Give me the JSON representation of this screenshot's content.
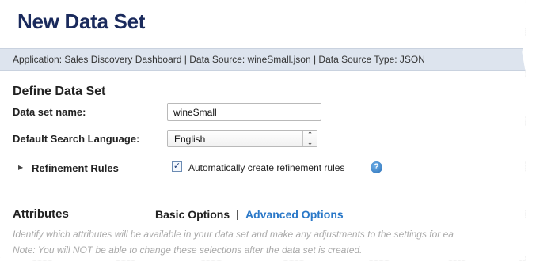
{
  "header": {
    "title": "New Data Set"
  },
  "info_bar": {
    "text": "Application: Sales Discovery Dashboard | Data Source: wineSmall.json | Data Source Type: JSON"
  },
  "define": {
    "section_title": "Define Data Set",
    "name_label": "Data set name:",
    "name_value": "wineSmall",
    "language_label": "Default Search Language:",
    "language_value": "English",
    "refinement_label": "Refinement Rules",
    "auto_refine_label": "Automatically create refinement rules",
    "auto_refine_checked": true
  },
  "attributes": {
    "title": "Attributes",
    "basic_options": "Basic Options",
    "separator": "|",
    "advanced_options": "Advanced Options",
    "hint_line1": "Identify which attributes will be available in your data set and make any adjustments to the settings for ea",
    "hint_line2": "Note: You will NOT be able to change these selections after the data set is created."
  },
  "icons": {
    "help": "help-icon",
    "expand": "triangle-right-icon",
    "select_arrow": "double-chevron-icon",
    "check": "checkmark-icon"
  },
  "colors": {
    "title": "#1a2a5c",
    "info_bar_bg": "#dde4ee",
    "link": "#2a78c8",
    "hint_text": "#a9a9a9"
  }
}
